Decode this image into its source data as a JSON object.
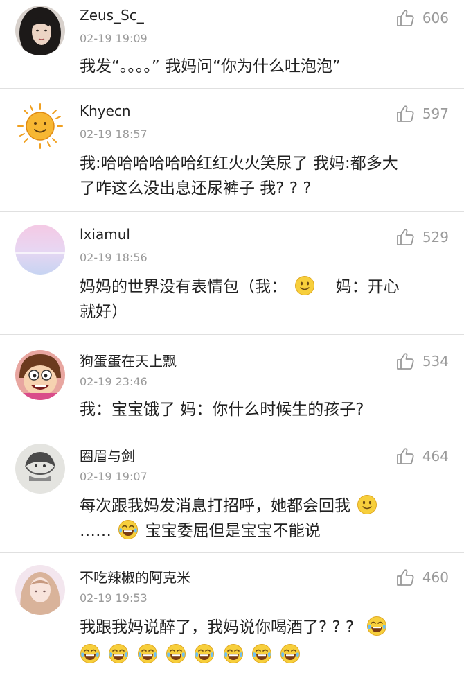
{
  "comments": [
    {
      "user": "Zeus_Sc_",
      "time": "02-19 19:09",
      "likes": "606",
      "lines": [
        {
          "t1": "我发“。。。。” 我妈问“你为什么吐泡泡”"
        }
      ]
    },
    {
      "user": "Khyecn",
      "time": "02-19 18:57",
      "likes": "597",
      "lines": [
        {
          "t1": "我:哈哈哈哈哈哈红红火火笑尿了 我妈:都多大"
        },
        {
          "t1": "了咋这么没出息还尿裤子   我? ? ?"
        }
      ]
    },
    {
      "user": "lxiamul",
      "time": "02-19 18:56",
      "likes": "529",
      "lines": [
        {
          "t1": "妈妈的世界没有表情包（我：",
          "t2": "妈：开心"
        },
        {
          "t1": "就好）"
        }
      ]
    },
    {
      "user": "狗蛋蛋在天上飘",
      "time": "02-19 23:46",
      "likes": "534",
      "lines": [
        {
          "t1": "我：宝宝饿了     妈：你什么时候生的孩子?"
        }
      ]
    },
    {
      "user": "圈眉与剑",
      "time": "02-19 19:07",
      "likes": "464",
      "lines": [
        {
          "t1": "每次跟我妈发消息打招呼，她都会回我"
        },
        {
          "t1": "……",
          "t2": "宝宝委屈但是宝宝不能说"
        }
      ]
    },
    {
      "user": "不吃辣椒的阿克米",
      "time": "02-19 19:53",
      "likes": "460",
      "lines": [
        {
          "t1": "我跟我妈说醉了，我妈说你喝酒了? ? ?"
        }
      ]
    }
  ],
  "emojis": {
    "smile": "smile-emoji",
    "laugh-cry": "laugh-cry-emoji"
  },
  "colors": {
    "muted": "#9a9a9a",
    "divider": "#e0e0e0",
    "emoji_yellow": "#f7cf3c"
  }
}
